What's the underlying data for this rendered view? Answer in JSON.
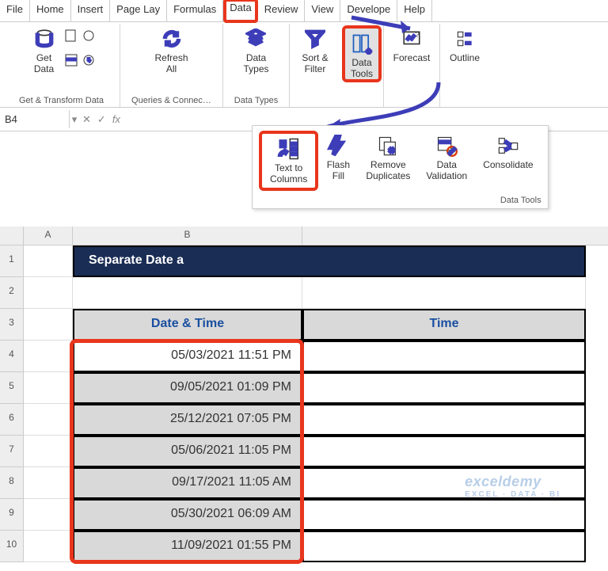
{
  "menu": {
    "items": [
      "File",
      "Home",
      "Insert",
      "Page Lay",
      "Formulas",
      "Data",
      "Review",
      "View",
      "Develope",
      "Help"
    ],
    "active_index": 5
  },
  "ribbon": {
    "groups": {
      "get_transform": {
        "label": "Get & Transform Data",
        "get_data": "Get\nData"
      },
      "queries": {
        "label": "Queries & Connec…",
        "refresh": "Refresh\nAll"
      },
      "datatypes": {
        "label": "Data Types",
        "types": "Data\nTypes"
      },
      "sortfilter": {
        "sort": "Sort &\nFilter"
      },
      "datatools_btn": {
        "label": "Data\nTools"
      },
      "forecast": {
        "label": "Forecast"
      },
      "outline": {
        "label": "Outline"
      }
    }
  },
  "subribbon": {
    "group_label": "Data Tools",
    "text_to_columns": "Text to\nColumns",
    "flash_fill": "Flash\nFill",
    "remove_dup": "Remove\nDuplicates",
    "data_validation": "Data\nValidation",
    "consolidate": "Consolidate"
  },
  "formula_bar": {
    "name_box": "B4",
    "fx": "fx"
  },
  "sheet": {
    "columns": [
      "A",
      "B"
    ],
    "title_cell": "Separate Date a",
    "header_b": "Date & Time",
    "header_c": "Time",
    "rows": [
      {
        "n": 1
      },
      {
        "n": 2
      },
      {
        "n": 3
      },
      {
        "n": 4,
        "dt": "05/03/2021 11:51 PM"
      },
      {
        "n": 5,
        "dt": "09/05/2021 01:09 PM"
      },
      {
        "n": 6,
        "dt": "25/12/2021  07:05 PM"
      },
      {
        "n": 7,
        "dt": "05/06/2021 11:05 PM"
      },
      {
        "n": 8,
        "dt": "09/17/2021 11:05 AM"
      },
      {
        "n": 9,
        "dt": "05/30/2021 06:09 AM"
      },
      {
        "n": 10,
        "dt": "11/09/2021 01:55 PM"
      }
    ]
  },
  "watermark": {
    "brand": "exceldemy",
    "tag": "EXCEL · DATA · BI"
  }
}
